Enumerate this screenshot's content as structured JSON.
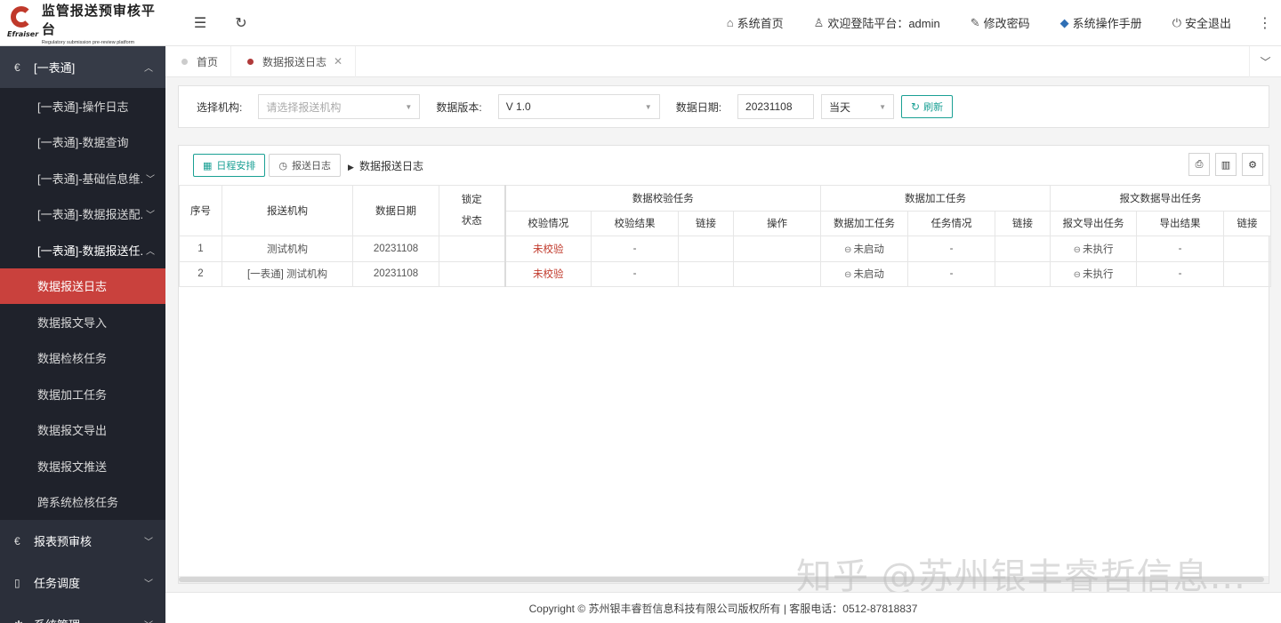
{
  "logo": {
    "brand": "Efraiser",
    "title": "监管报送预审核平台",
    "subtitle": "Regulatory submission pre-review platform"
  },
  "sidebar": {
    "group1": {
      "label": "[一表通]",
      "items": [
        {
          "label": "[一表通]-操作日志"
        },
        {
          "label": "[一表通]-数据查询"
        },
        {
          "label": "[一表通]-基础信息维..."
        },
        {
          "label": "[一表通]-数据报送配..."
        },
        {
          "label": "[一表通]-数据报送任..."
        },
        {
          "label": "数据报送日志"
        },
        {
          "label": "数据报文导入"
        },
        {
          "label": "数据检核任务"
        },
        {
          "label": "数据加工任务"
        },
        {
          "label": "数据报文导出"
        },
        {
          "label": "数据报文推送"
        },
        {
          "label": "跨系统检核任务"
        }
      ]
    },
    "group2": {
      "label": "报表预审核"
    },
    "group3": {
      "label": "任务调度"
    },
    "group4": {
      "label": "系统管理"
    }
  },
  "topbar": {
    "home": "系统首页",
    "welcome": "欢迎登陆平台：admin",
    "change_password": "修改密码",
    "manual": "系统操作手册",
    "logout": "安全退出"
  },
  "tabs": [
    {
      "label": "首页"
    },
    {
      "label": "数据报送日志"
    }
  ],
  "filter": {
    "org_label": "选择机构:",
    "org_placeholder": "请选择报送机构",
    "version_label": "数据版本:",
    "version_value": "V 1.0",
    "date_label": "数据日期:",
    "date_value": "20231108",
    "range_value": "当天",
    "refresh": "刷新"
  },
  "toolbar": {
    "schedule": "日程安排",
    "log": "报送日志",
    "crumb": "数据报送日志"
  },
  "table": {
    "headers": {
      "seq": "序号",
      "org": "报送机构",
      "date": "数据日期",
      "lock_line1": "锁定",
      "lock_line2": "状态",
      "verify_group": "数据校验任务",
      "process_group": "数据加工任务",
      "export_group": "报文数据导出任务",
      "verify_status": "校验情况",
      "verify_result": "校验结果",
      "link1": "链接",
      "action": "操作",
      "process_task": "数据加工任务",
      "task_status": "任务情况",
      "link2": "链接",
      "export_task": "报文导出任务",
      "export_result": "导出结果",
      "link3": "链接"
    },
    "rows": [
      {
        "seq": "1",
        "org": "测试机构",
        "date": "20231108",
        "lock": "",
        "verify_status": "未校验",
        "verify_result": "-",
        "link1": "",
        "action": "",
        "process_task": "未启动",
        "task_status": "-",
        "link2": "",
        "export_task": "未执行",
        "export_result": "-",
        "link3": ""
      },
      {
        "seq": "2",
        "org": "[一表通] 测试机构",
        "date": "20231108",
        "lock": "",
        "verify_status": "未校验",
        "verify_result": "-",
        "link1": "",
        "action": "",
        "process_task": "未启动",
        "task_status": "-",
        "link2": "",
        "export_task": "未执行",
        "export_result": "-",
        "link3": ""
      }
    ]
  },
  "footer": "Copyright © 苏州银丰睿哲信息科技有限公司版权所有 | 客服电话：0512-87818837",
  "watermark": "知乎 @苏州银丰睿哲信息...",
  "colors": {
    "active_menu": "#c9413d",
    "accent_green": "#1aa094",
    "sidebar_bg": "#2b2f3a",
    "unverified_red": "#c0392b"
  }
}
